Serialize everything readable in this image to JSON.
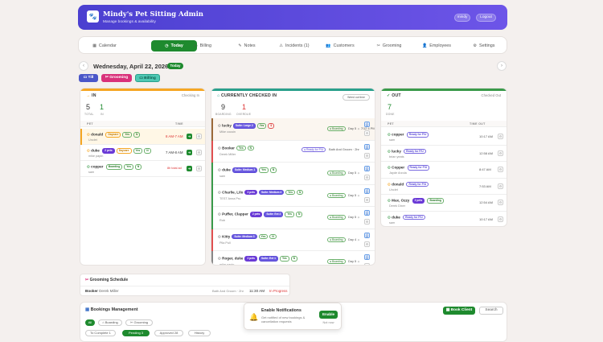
{
  "header": {
    "title": "Mindy's Pet Sitting Admin",
    "subtitle": "Manage bookings & availability",
    "user_label": "mindy",
    "logout_label": "Logout"
  },
  "nav": [
    "Calendar",
    "Today",
    "Billing",
    "Notes",
    "Incidents (1)",
    "Customers",
    "Grooming",
    "Employees",
    "Settings"
  ],
  "date_label": "Wednesday, April 22, 2026",
  "today_badge": "Today",
  "filters": [
    "Till",
    "Grooming",
    "Billing"
  ],
  "in_panel": {
    "title": "IN",
    "status": "Checking In",
    "total": "5",
    "total_label": "TOTAL",
    "in": "1",
    "in_label": "IN",
    "pet_col": "PET",
    "time_col": "TIME",
    "rows": [
      {
        "name": "donald",
        "owner": "Unclet",
        "tags": [
          "Daycare",
          "Yes",
          "N"
        ],
        "time": "8 AM-7 AM",
        "late": true
      },
      {
        "name": "duke",
        "badge": "2 pets",
        "owner": "mike papin",
        "tags": [
          "Daycare",
          "Yes",
          "N"
        ],
        "time": "7 AM-8 AM",
        "late": false
      },
      {
        "name": "copper",
        "owner": "sam",
        "tags": [
          "Boarding",
          "Yes",
          "N"
        ],
        "time": "8h total ad",
        "late": true
      }
    ]
  },
  "checked_panel": {
    "title": "CURRENTLY CHECKED IN",
    "boarding": "9",
    "boarding_label": "BOARDING",
    "overdue": "1",
    "overdue_label": "OVERDUE",
    "toggle_label": "Weed out time",
    "rows": [
      {
        "name": "lucky",
        "owner": "Mike cousin",
        "tags": [
          "Suite: Large 2",
          "Yes",
          "$"
        ],
        "status": "Boarding",
        "day": "Day 5 ☼ 7/12 4 PM-5 PM",
        "color": "#9b6a3a"
      },
      {
        "name": "Booker",
        "owner": "Derek Miller",
        "tags": [
          "Yes",
          "N"
        ],
        "status": "Ready for P/U",
        "day": "Bath And Groom · 2hr",
        "color": "#e05050"
      },
      {
        "name": "duke",
        "owner": "sam",
        "tags": [
          "Suite: Medium 1",
          "Yes",
          "N"
        ],
        "status": "Boarding",
        "day": "Day 5 ☼",
        "color": "#3a9a4a"
      },
      {
        "name": "Charlie, Lilo",
        "badge": "2 pets",
        "owner": "TEST Anna Pru",
        "tags": [
          "Suite: Medium 4",
          "Yes",
          "N"
        ],
        "status": "Boarding",
        "day": "Day 5 ☼",
        "color": "#3a9a4a"
      },
      {
        "name": "Puffer, Clapper",
        "badge": "2 pets",
        "owner": "Rob",
        "tags": [
          "Suite: Ext 2",
          "Yes",
          "N"
        ],
        "status": "Boarding",
        "day": "Day 5 ☼",
        "color": "#3a9a4a"
      },
      {
        "name": "Kitty",
        "owner": "Pila Pull",
        "tags": [
          "Suite: Medium 3",
          "Yes",
          "N"
        ],
        "status": "Boarding",
        "day": "Day 4 ☼",
        "color": "#e05050"
      },
      {
        "name": "Roger, duke",
        "badge": "2 pets",
        "owner": "mike papin",
        "tags": [
          "Suite: Ext 1",
          "Yes",
          "N"
        ],
        "status": "Boarding",
        "day": "Day 5 ☼",
        "color": "#888"
      }
    ]
  },
  "out_panel": {
    "title": "OUT",
    "status": "Checked Out",
    "done": "7",
    "done_label": "DONE",
    "pet_col": "PET",
    "time_col": "TIME OUT",
    "rows": [
      {
        "name": "copper",
        "owner": "sam",
        "tag": "Ready for P/U",
        "time": "10:17 AM"
      },
      {
        "name": "lucky",
        "owner": "brian yeats",
        "tag": "Ready for P/U",
        "time": "12:58 AM"
      },
      {
        "name": "Copper",
        "owner": "Jayde Arzola",
        "tag": "Ready for P/U",
        "time": "8:47 AM"
      },
      {
        "name": "donald",
        "owner": "Unclet",
        "tag": "Ready for P/U",
        "time": "7:53 AM"
      },
      {
        "name": "Max, Ozzy",
        "badge": "2 pets",
        "owner": "Derek Dixer",
        "tag": "Boarding",
        "time": "12:54 AM"
      },
      {
        "name": "duke",
        "owner": "sam",
        "tag": "Ready for P/U",
        "time": "10:17 AM"
      }
    ]
  },
  "grooming": {
    "title": "Grooming Schedule",
    "pet": "Booker",
    "owner": "Derek Miller",
    "service": "Bath And Groom · 2hr",
    "time": "11:30 AM",
    "status": "In Progress"
  },
  "bookings": {
    "title": "Bookings Management",
    "book_btn": "Book Client",
    "search": "Search",
    "tabs": [
      "All",
      "Boarding",
      "Grooming"
    ],
    "status_tabs": [
      "To Complete 1",
      "Pending 3",
      "Approved 28",
      "History"
    ]
  },
  "toast": {
    "title": "Enable Notifications",
    "body": "Get notified of new bookings & cancellation requests",
    "enable": "Enable",
    "later": "Not now"
  }
}
